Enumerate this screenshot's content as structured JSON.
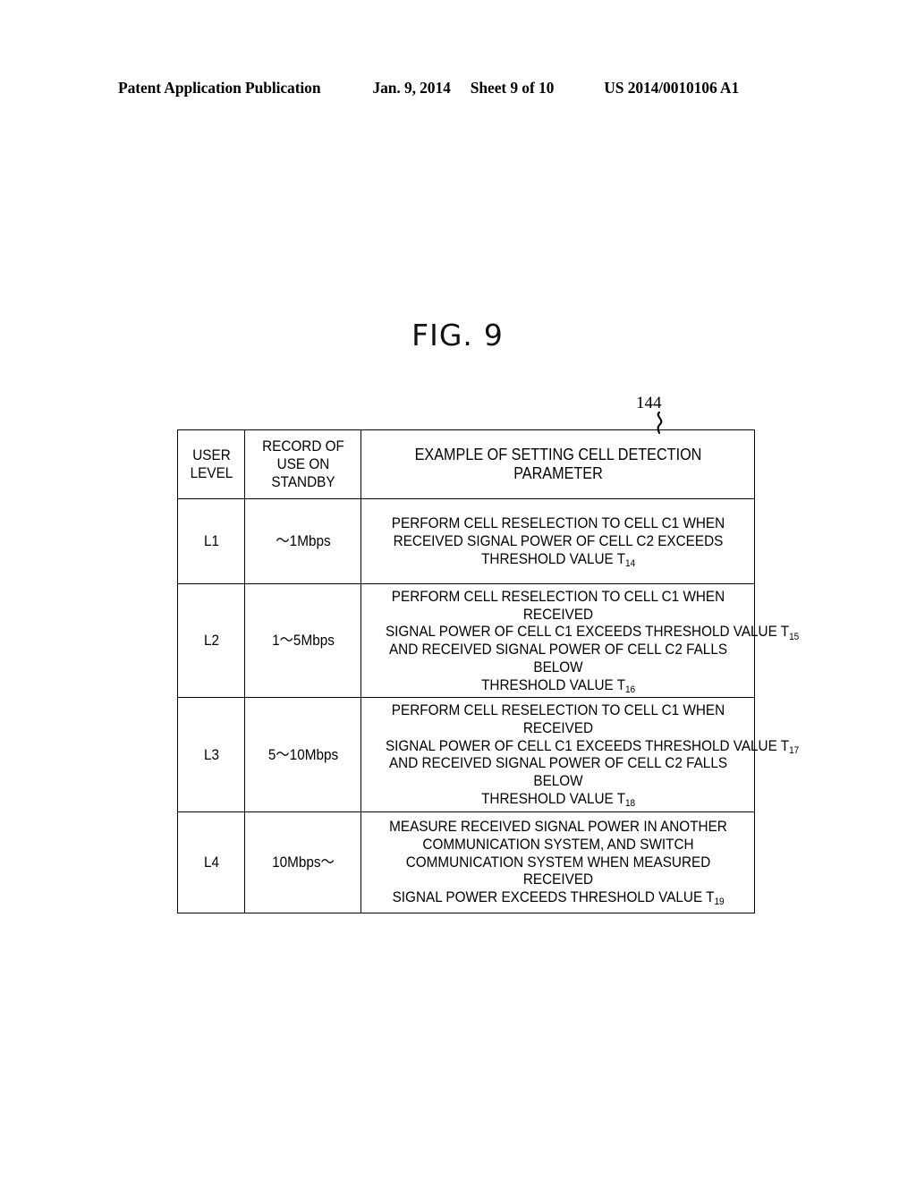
{
  "page_header": {
    "publication": "Patent Application Publication",
    "date": "Jan. 9, 2014",
    "sheet": "Sheet 9 of 10",
    "patent_number": "US 2014/0010106 A1"
  },
  "figure": {
    "title_word": "FIG.",
    "title_number": "9",
    "reference_numeral": "144"
  },
  "table": {
    "headers": {
      "user_level": "USER\nLEVEL",
      "user_level_line1": "USER",
      "user_level_line2": "LEVEL",
      "record_line1": "RECORD OF",
      "record_line2": "USE ON",
      "record_line3": "STANDBY",
      "parameter": "EXAMPLE OF SETTING CELL DETECTION PARAMETER"
    },
    "rows": [
      {
        "level": "L1",
        "rate": "〜1Mbps",
        "desc_lines": [
          "PERFORM CELL RESELECTION TO CELL C1 WHEN",
          "RECEIVED SIGNAL POWER OF CELL C2 EXCEEDS",
          "THRESHOLD VALUE T"
        ],
        "threshold_sub_1": "14"
      },
      {
        "level": "L2",
        "rate": "1〜5Mbps",
        "desc_lines": [
          "PERFORM CELL RESELECTION TO CELL C1 WHEN RECEIVED",
          "SIGNAL POWER OF CELL C1 EXCEEDS THRESHOLD VALUE T",
          "AND RECEIVED SIGNAL POWER OF CELL C2 FALLS BELOW",
          "THRESHOLD VALUE T"
        ],
        "threshold_sub_1": "15",
        "threshold_sub_2": "16"
      },
      {
        "level": "L3",
        "rate": "5〜10Mbps",
        "desc_lines": [
          "PERFORM CELL RESELECTION TO CELL C1 WHEN RECEIVED",
          "SIGNAL POWER OF CELL C1 EXCEEDS THRESHOLD VALUE T",
          "AND RECEIVED SIGNAL POWER OF CELL C2 FALLS BELOW",
          "THRESHOLD VALUE T"
        ],
        "threshold_sub_1": "17",
        "threshold_sub_2": "18"
      },
      {
        "level": "L4",
        "rate": "10Mbps〜",
        "desc_lines": [
          "MEASURE RECEIVED SIGNAL POWER IN ANOTHER",
          "COMMUNICATION SYSTEM, AND SWITCH",
          "COMMUNICATION SYSTEM WHEN MEASURED RECEIVED",
          "SIGNAL POWER EXCEEDS THRESHOLD VALUE T"
        ],
        "threshold_sub_1": "19"
      }
    ]
  },
  "colors": {
    "ink": "#000000",
    "page": "#ffffff"
  }
}
